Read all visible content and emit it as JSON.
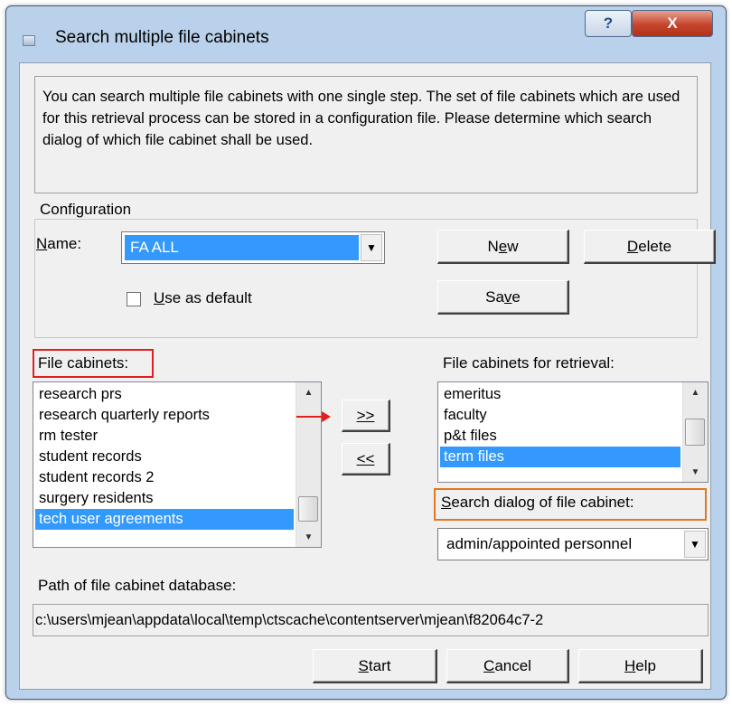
{
  "window": {
    "title": "Search multiple file cabinets",
    "help_glyph": "?",
    "close_glyph": "X"
  },
  "description": "You can search multiple file cabinets with one single step. The set of file cabinets which are used for this retrieval process can be stored in a configuration file. Please determine which search dialog of which file cabinet shall be used.",
  "configuration": {
    "group_label": "Configuration",
    "name_label_u": "N",
    "name_label_rest": "ame:",
    "name_value": "FA ALL",
    "new_u": "N",
    "new_mid": "e",
    "new_u2": "w",
    "new_label_pre": "N",
    "new_label_u": "e",
    "new_label_post": "w",
    "delete_pre": "",
    "delete_u": "D",
    "delete_post": "elete",
    "use_default_u": "U",
    "use_default_rest": "se as default",
    "save_pre": "Sa",
    "save_u": "v",
    "save_post": "e"
  },
  "file_cabinets": {
    "label": "File cabinets:",
    "items": [
      "research prs",
      "research quarterly reports",
      "rm tester",
      "student records",
      "student records 2",
      "surgery residents",
      "tech user agreements"
    ],
    "selected_index": 6
  },
  "move_buttons": {
    "add": ">>",
    "remove": "<<"
  },
  "retrieval": {
    "label": "File cabinets for retrieval:",
    "items": [
      "emeritus",
      "faculty",
      "p&t files",
      "term files"
    ],
    "selected_index": 3
  },
  "search_dialog": {
    "label_u": "S",
    "label_rest": "earch dialog of file cabinet:",
    "value": "admin/appointed personnel"
  },
  "path": {
    "label": "Path of file cabinet database:",
    "value": "c:\\users\\mjean\\appdata\\local\\temp\\ctscache\\contentserver\\mjean\\f82064c7-2"
  },
  "footer": {
    "start_u": "S",
    "start_rest": "tart",
    "cancel_u": "C",
    "cancel_rest": "ancel",
    "help_u": "H",
    "help_rest": "elp"
  },
  "colors": {
    "selection": "#3399ff",
    "highlight_red": "#e02020",
    "highlight_orange": "#e07a20",
    "frame": "#b9d1ea"
  }
}
